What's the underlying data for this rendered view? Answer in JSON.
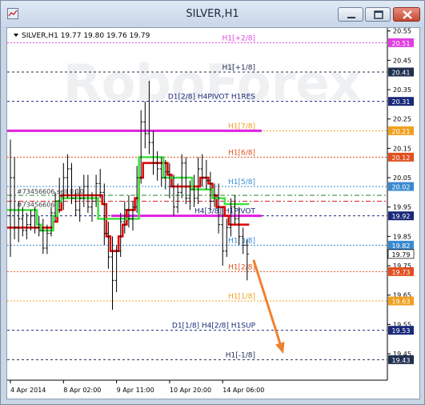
{
  "window": {
    "title": "SILVER,H1"
  },
  "chart_data": {
    "type": "line",
    "symbol_header": "SILVER,H1  19.77 19.80 19.76 19.79",
    "watermark": "RoboForex",
    "ylim": [
      19.36,
      20.56
    ],
    "y_ticks": [
      {
        "value": 20.55,
        "label": "20.55"
      },
      {
        "value": 20.45,
        "label": "20.45"
      },
      {
        "value": 20.35,
        "label": "20.35"
      },
      {
        "value": 20.25,
        "label": "20.25"
      },
      {
        "value": 20.15,
        "label": "20.15"
      },
      {
        "value": 20.05,
        "label": "20.05"
      },
      {
        "value": 19.95,
        "label": "19.95"
      },
      {
        "value": 19.85,
        "label": "19.85"
      },
      {
        "value": 19.75,
        "label": "19.75"
      },
      {
        "value": 19.65,
        "label": "19.65"
      },
      {
        "value": 19.55,
        "label": "19.55"
      },
      {
        "value": 19.45,
        "label": "19.45"
      }
    ],
    "x_ticks": [
      "4 Apr 2014",
      "8 Apr 02:00",
      "9 Apr 11:00",
      "10 Apr 20:00",
      "14 Apr 06:00"
    ],
    "levels": [
      {
        "label": "H1[+2/8]",
        "value": 20.51,
        "color": "#e040e0",
        "tag": "20.51",
        "dash": "dot",
        "width": 1
      },
      {
        "label": "H1[+1/8]",
        "value": 20.41,
        "color": "#20304f",
        "tag": "20.41",
        "dash": "dash",
        "width": 1
      },
      {
        "label": "D1[2/8] H4PIVOT H1RES",
        "value": 20.31,
        "color": "#1a2a7a",
        "tag": "20.31",
        "dash": "dash",
        "width": 1
      },
      {
        "label": "H1[7/8]",
        "value": 20.21,
        "color": "#f0a020",
        "tag": "20.21",
        "dash": "dot",
        "width": 1
      },
      {
        "label": "H1[6/8]",
        "value": 20.12,
        "color": "#e05020",
        "tag": "20.12",
        "dash": "dot",
        "width": 1
      },
      {
        "label": "H1[5/8]",
        "value": 20.02,
        "color": "#3a8ad0",
        "tag": "20.02",
        "dash": "dot",
        "width": 1
      },
      {
        "label": "H4[3/8] H1PIVOT",
        "value": 19.92,
        "color": "#1a2a7a",
        "tag": "19.92",
        "dash": "dash",
        "width": 1
      },
      {
        "label": "H1[3/8]",
        "value": 19.82,
        "color": "#3a8ad0",
        "tag": "19.82",
        "dash": "dot",
        "width": 1
      },
      {
        "label": "H1[2/8]",
        "value": 19.73,
        "color": "#e05020",
        "tag": "19.73",
        "dash": "dot",
        "width": 1
      },
      {
        "label": "H1[1/8]",
        "value": 19.63,
        "color": "#f0a020",
        "tag": "19.63",
        "dash": "dot",
        "width": 1
      },
      {
        "label": "D1[1/8] H4[2/8] H1SUP",
        "value": 19.53,
        "color": "#1a2a7a",
        "tag": "19.53",
        "dash": "dash",
        "width": 1
      },
      {
        "label": "H1[-1/8]",
        "value": 19.43,
        "color": "#20304f",
        "tag": "19.43",
        "dash": "dash",
        "width": 1
      }
    ],
    "current_price": {
      "value": 19.79,
      "tag": "19.79"
    },
    "orders": [
      {
        "label": "#73456606 sell 0.10",
        "value": 19.99
      },
      {
        "label": "#73456606 sl",
        "value": 19.97
      }
    ],
    "price_ohlc": [
      [
        19.92,
        20.18,
        19.78,
        20.05
      ],
      [
        20.05,
        20.12,
        19.84,
        19.88
      ],
      [
        19.88,
        19.97,
        19.83,
        19.91
      ],
      [
        19.91,
        19.95,
        19.85,
        19.87
      ],
      [
        19.87,
        19.93,
        19.84,
        19.89
      ],
      [
        19.89,
        19.94,
        19.87,
        19.92
      ],
      [
        19.92,
        19.95,
        19.86,
        19.88
      ],
      [
        19.88,
        19.92,
        19.85,
        19.87
      ],
      [
        19.87,
        19.91,
        19.79,
        19.81
      ],
      [
        19.81,
        19.89,
        19.79,
        19.86
      ],
      [
        19.86,
        19.95,
        19.85,
        19.93
      ],
      [
        19.93,
        20.0,
        19.9,
        19.97
      ],
      [
        19.97,
        20.05,
        19.93,
        19.99
      ],
      [
        19.99,
        20.1,
        19.94,
        20.05
      ],
      [
        20.05,
        20.13,
        19.98,
        20.08
      ],
      [
        20.08,
        20.1,
        19.96,
        19.98
      ],
      [
        19.98,
        20.01,
        19.92,
        19.94
      ],
      [
        19.94,
        20.02,
        19.9,
        19.98
      ],
      [
        19.98,
        20.06,
        19.95,
        20.02
      ],
      [
        20.02,
        20.06,
        19.93,
        19.95
      ],
      [
        19.95,
        20.0,
        19.9,
        19.97
      ],
      [
        19.97,
        20.06,
        19.95,
        20.03
      ],
      [
        20.03,
        20.08,
        19.98,
        20.0
      ],
      [
        20.0,
        20.03,
        19.82,
        19.86
      ],
      [
        19.86,
        19.9,
        19.74,
        19.78
      ],
      [
        19.78,
        19.85,
        19.6,
        19.7
      ],
      [
        19.7,
        19.82,
        19.66,
        19.8
      ],
      [
        19.8,
        19.93,
        19.78,
        19.9
      ],
      [
        19.9,
        19.97,
        19.86,
        19.94
      ],
      [
        19.94,
        19.99,
        19.88,
        19.91
      ],
      [
        19.91,
        19.97,
        19.87,
        19.95
      ],
      [
        19.95,
        20.09,
        19.93,
        20.05
      ],
      [
        20.05,
        20.28,
        20.03,
        20.24
      ],
      [
        20.24,
        20.31,
        20.15,
        20.2
      ],
      [
        20.2,
        20.38,
        20.13,
        20.17
      ],
      [
        20.17,
        20.21,
        20.06,
        20.1
      ],
      [
        20.1,
        20.14,
        20.04,
        20.08
      ],
      [
        20.08,
        20.12,
        20.02,
        20.05
      ],
      [
        20.05,
        20.11,
        20.01,
        20.07
      ],
      [
        20.07,
        20.1,
        19.98,
        20.02
      ],
      [
        20.02,
        20.06,
        19.92,
        19.95
      ],
      [
        19.95,
        20.03,
        19.93,
        20.0
      ],
      [
        20.0,
        20.13,
        19.98,
        20.1
      ],
      [
        20.1,
        20.12,
        19.96,
        19.98
      ],
      [
        19.98,
        20.04,
        19.94,
        20.01
      ],
      [
        20.01,
        20.06,
        19.95,
        19.98
      ],
      [
        19.98,
        20.12,
        19.96,
        20.08
      ],
      [
        20.08,
        20.13,
        20.02,
        20.05
      ],
      [
        20.05,
        20.11,
        20.01,
        20.04
      ],
      [
        20.04,
        20.07,
        19.94,
        19.97
      ],
      [
        19.97,
        20.03,
        19.95,
        19.99
      ],
      [
        19.99,
        20.03,
        19.86,
        19.89
      ],
      [
        19.89,
        19.95,
        19.75,
        19.8
      ],
      [
        19.8,
        19.91,
        19.78,
        19.88
      ],
      [
        19.88,
        19.98,
        19.85,
        19.95
      ],
      [
        19.95,
        19.99,
        19.89,
        19.91
      ],
      [
        19.91,
        19.95,
        19.82,
        19.85
      ],
      [
        19.85,
        19.88,
        19.79,
        19.82
      ],
      [
        19.82,
        19.84,
        19.7,
        19.79
      ]
    ],
    "series": [
      {
        "color": "#e00000",
        "values": [
          19.88,
          19.88,
          19.88,
          19.88,
          19.88,
          19.88,
          19.88,
          19.88,
          19.88,
          19.88,
          19.88,
          19.9,
          19.94,
          19.99,
          19.99,
          19.99,
          19.99,
          19.99,
          19.99,
          19.99,
          19.99,
          19.99,
          19.99,
          19.96,
          19.85,
          19.8,
          19.8,
          19.85,
          19.89,
          19.94,
          19.94,
          19.98,
          20.05,
          20.1,
          20.1,
          20.1,
          20.1,
          20.1,
          20.1,
          20.06,
          20.02,
          20.02,
          20.02,
          20.02,
          20.02,
          20.02,
          20.02,
          20.05,
          20.05,
          20.03,
          19.99,
          19.95,
          19.95,
          19.92,
          19.89,
          19.89,
          19.89,
          19.89,
          19.89
        ]
      },
      {
        "color": "#40e040",
        "values": [
          19.94,
          19.94,
          19.94,
          19.94,
          19.94,
          19.94,
          19.94,
          19.89,
          19.87,
          19.87,
          19.87,
          19.92,
          19.97,
          19.98,
          19.98,
          19.98,
          19.98,
          19.98,
          19.98,
          19.98,
          19.98,
          19.98,
          19.91,
          19.91,
          19.91,
          19.91,
          19.91,
          19.91,
          19.91,
          19.91,
          19.91,
          19.91,
          20.12,
          20.12,
          20.12,
          20.12,
          20.12,
          20.12,
          20.05,
          20.05,
          20.05,
          20.05,
          20.05,
          20.05,
          20.05,
          20.01,
          20.01,
          20.01,
          20.01,
          20.01,
          19.98,
          19.98,
          19.98,
          19.96,
          19.96,
          19.96,
          19.96,
          19.96,
          19.96
        ]
      }
    ],
    "forecast_arrow": {
      "from_value": 19.77,
      "to_value": 19.45,
      "color": "#f08030"
    }
  }
}
